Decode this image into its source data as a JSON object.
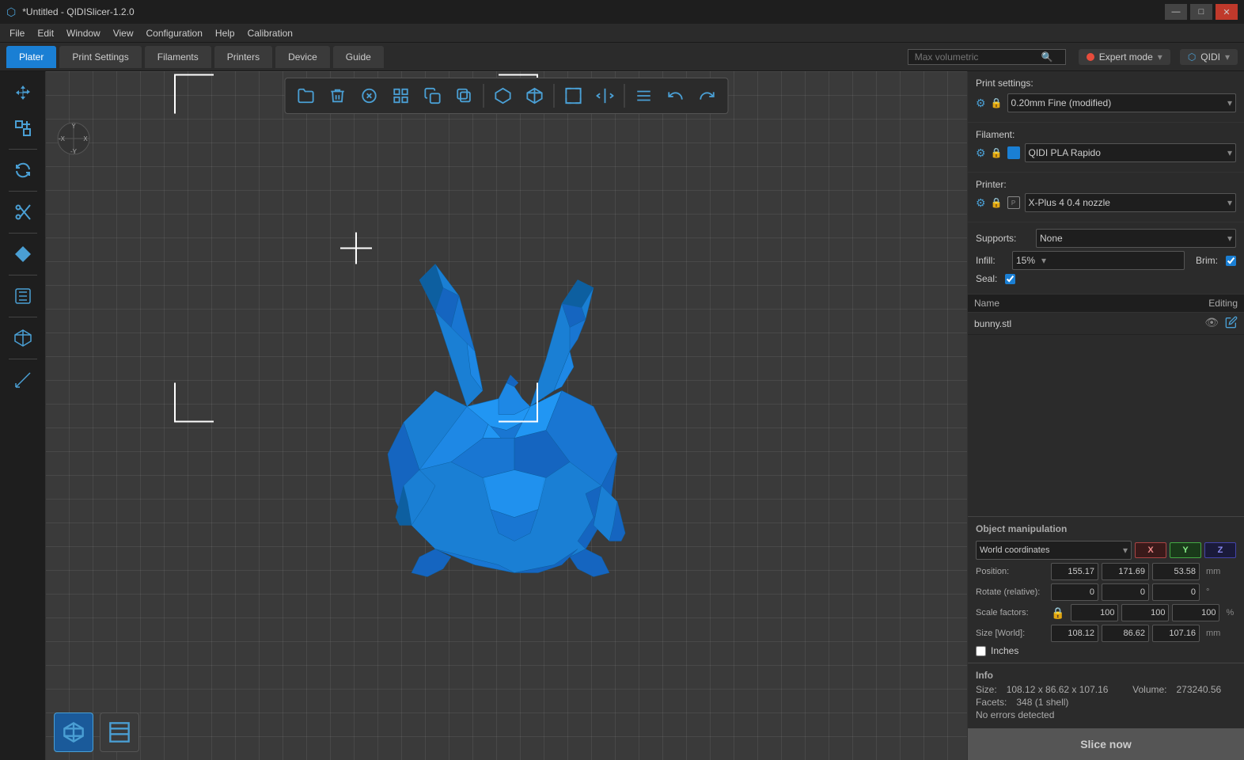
{
  "titlebar": {
    "title": "*Untitled - QIDISlicer-1.2.0",
    "min_label": "—",
    "max_label": "□",
    "close_label": "✕"
  },
  "menubar": {
    "items": [
      "File",
      "Edit",
      "Window",
      "View",
      "Configuration",
      "Help",
      "Calibration"
    ]
  },
  "tabbar": {
    "tabs": [
      "Plater",
      "Print Settings",
      "Filaments",
      "Printers",
      "Device",
      "Guide"
    ],
    "active": "Plater",
    "search_placeholder": "Max volumetric",
    "expert_mode_label": "Expert mode",
    "qidi_label": "QIDI"
  },
  "toolbar": {
    "buttons": [
      {
        "name": "open-folder",
        "icon": "📂"
      },
      {
        "name": "delete",
        "icon": "🗑"
      },
      {
        "name": "close",
        "icon": "✖"
      },
      {
        "name": "grid",
        "icon": "▦"
      },
      {
        "name": "copy",
        "icon": "⧉"
      },
      {
        "name": "paste",
        "icon": "📋"
      },
      {
        "name": "rotate",
        "icon": "⟳"
      },
      {
        "name": "cube-3d",
        "icon": "⬡"
      },
      {
        "name": "fit-screen",
        "icon": "⊞"
      },
      {
        "name": "flip-h",
        "icon": "↔"
      },
      {
        "name": "list",
        "icon": "☰"
      },
      {
        "name": "undo",
        "icon": "↩"
      },
      {
        "name": "redo",
        "icon": "↪"
      }
    ]
  },
  "left_toolbar": {
    "tools": [
      {
        "name": "move",
        "icon": "✛"
      },
      {
        "name": "scale",
        "icon": "⤢"
      },
      {
        "name": "rotate-tool",
        "icon": "↻"
      },
      {
        "name": "cut",
        "icon": "✂"
      },
      {
        "name": "diamond",
        "icon": "◆"
      },
      {
        "name": "layer",
        "icon": "⬡"
      },
      {
        "name": "cube",
        "icon": "⬛"
      },
      {
        "name": "ruler",
        "icon": "📏"
      }
    ]
  },
  "right_panel": {
    "print_settings_label": "Print settings:",
    "print_settings_value": "0.20mm Fine (modified)",
    "filament_label": "Filament:",
    "filament_value": "QIDI PLA Rapido",
    "printer_label": "Printer:",
    "printer_value": "X-Plus 4 0.4 nozzle",
    "supports_label": "Supports:",
    "supports_value": "None",
    "infill_label": "Infill:",
    "infill_value": "15%",
    "brim_label": "Brim:",
    "brim_checked": true,
    "seal_label": "Seal:",
    "seal_checked": true
  },
  "objects_table": {
    "col_name": "Name",
    "col_editing": "Editing",
    "rows": [
      {
        "name": "bunny.stl",
        "visible": true,
        "edit": true
      }
    ]
  },
  "object_manipulation": {
    "title": "Object manipulation",
    "coord_system": "World coordinates",
    "x_label": "X",
    "y_label": "Y",
    "z_label": "Z",
    "position_label": "Position:",
    "position_x": "155.17",
    "position_y": "171.69",
    "position_z": "53.58",
    "position_unit": "mm",
    "rotate_label": "Rotate (relative):",
    "rotate_x": "0",
    "rotate_y": "0",
    "rotate_z": "0",
    "rotate_unit": "°",
    "scale_label": "Scale factors:",
    "scale_x": "100",
    "scale_y": "100",
    "scale_z": "100",
    "scale_unit": "%",
    "size_label": "Size [World]:",
    "size_x": "108.12",
    "size_y": "86.62",
    "size_z": "107.16",
    "size_unit": "mm",
    "inches_label": "Inches"
  },
  "info": {
    "title": "Info",
    "size_label": "Size:",
    "size_value": "108.12 x 86.62 x 107.16",
    "volume_label": "Volume:",
    "volume_value": "273240.56",
    "facets_label": "Facets:",
    "facets_value": "348 (1 shell)",
    "errors_label": "No errors detected"
  },
  "slice_button_label": "Slice now",
  "bottom_icons": [
    {
      "name": "cube-view",
      "icon": "⬡",
      "active": true
    },
    {
      "name": "layers-view",
      "icon": "⬛",
      "active": false
    }
  ],
  "colors": {
    "accent": "#1a7fd4",
    "bg": "#2b2b2b",
    "panel_bg": "#1e1e1e",
    "border": "#444",
    "text": "#ccc",
    "bunny": "#1a7fd4"
  }
}
